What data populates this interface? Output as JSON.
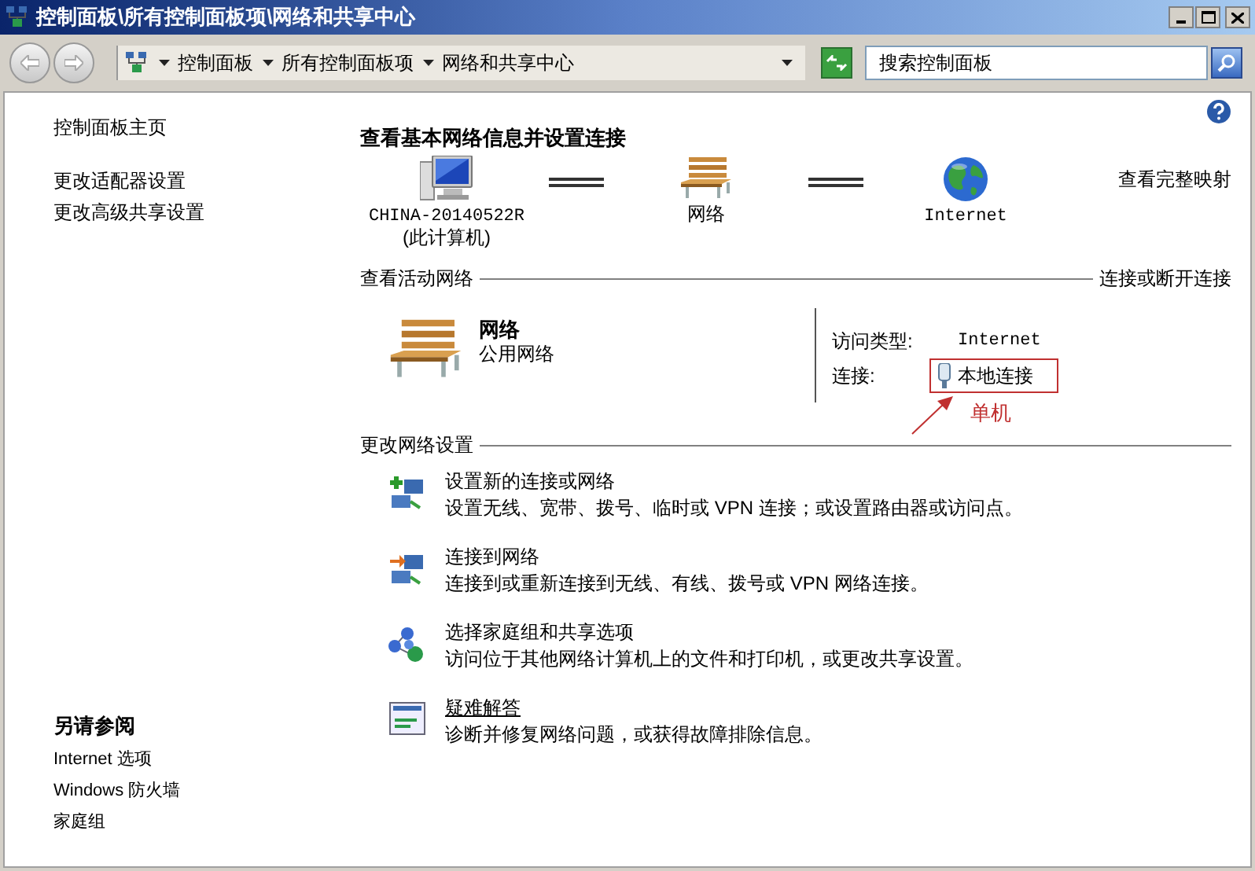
{
  "window": {
    "title": "控制面板\\所有控制面板项\\网络和共享中心"
  },
  "toolbar": {
    "breadcrumb": [
      "控制面板",
      "所有控制面板项",
      "网络和共享中心"
    ],
    "search": {
      "placeholder": "搜索控制面板"
    }
  },
  "sidebar": {
    "links": [
      "控制面板主页",
      "更改适配器设置",
      "更改高级共享设置"
    ],
    "see_also": {
      "title": "另请参阅",
      "links": [
        "Internet 选项",
        "Windows 防火墙",
        "家庭组"
      ]
    }
  },
  "main": {
    "heading": "查看基本网络信息并设置连接",
    "full_map_link": "查看完整映射",
    "map": [
      {
        "kind": "computer",
        "label": "CHINA-20140522R",
        "sublabel": "(此计算机)"
      },
      {
        "kind": "network",
        "label": "网络"
      },
      {
        "kind": "internet",
        "label": "Internet"
      }
    ],
    "active": {
      "title": "查看活动网络",
      "action": "连接或断开连接",
      "network": {
        "name": "网络",
        "type": "公用网络"
      },
      "access_label": "访问类型:",
      "access_value": "Internet",
      "connection_label": "连接:",
      "connection_value": "本地连接"
    },
    "annotation": {
      "text": "单机"
    },
    "settings": {
      "title": "更改网络设置",
      "tasks": [
        {
          "kind": "new",
          "title": "设置新的连接或网络",
          "desc": "设置无线、宽带、拨号、临时或 VPN 连接；或设置路由器或访问点。",
          "hovered": false
        },
        {
          "kind": "connect",
          "title": "连接到网络",
          "desc": "连接到或重新连接到无线、有线、拨号或 VPN 网络连接。",
          "hovered": false
        },
        {
          "kind": "homegroup",
          "title": "选择家庭组和共享选项",
          "desc": "访问位于其他网络计算机上的文件和打印机，或更改共享设置。",
          "hovered": false
        },
        {
          "kind": "troubleshoot",
          "title": "疑难解答",
          "desc": "诊断并修复网络问题，或获得故障排除信息。",
          "hovered": true
        }
      ]
    }
  }
}
